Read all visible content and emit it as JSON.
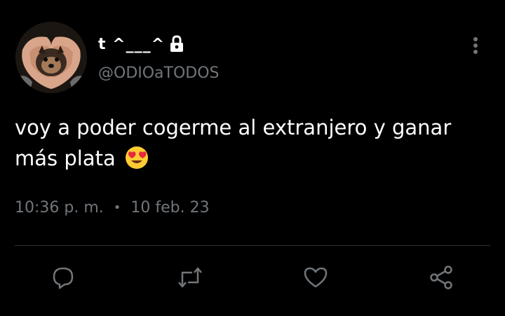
{
  "tweet": {
    "display_name": "t ^___^",
    "handle": "@ODIOaTODOS",
    "text": "voy a poder cogerme al extranjero y ganar más plata",
    "emoji": "smiling-face-with-heart-eyes-emoji",
    "time": "10:36 p. m.",
    "separator": "•",
    "date": "10 feb. 23"
  },
  "icons": {
    "lock": "lock-icon",
    "more": "more-vertical-icon",
    "reply": "reply-icon",
    "retweet": "retweet-icon",
    "like": "heart-icon",
    "share": "share-icon"
  },
  "colors": {
    "background": "#000000",
    "text": "#ffffff",
    "secondary": "#71767b",
    "divider": "#2f3336"
  }
}
